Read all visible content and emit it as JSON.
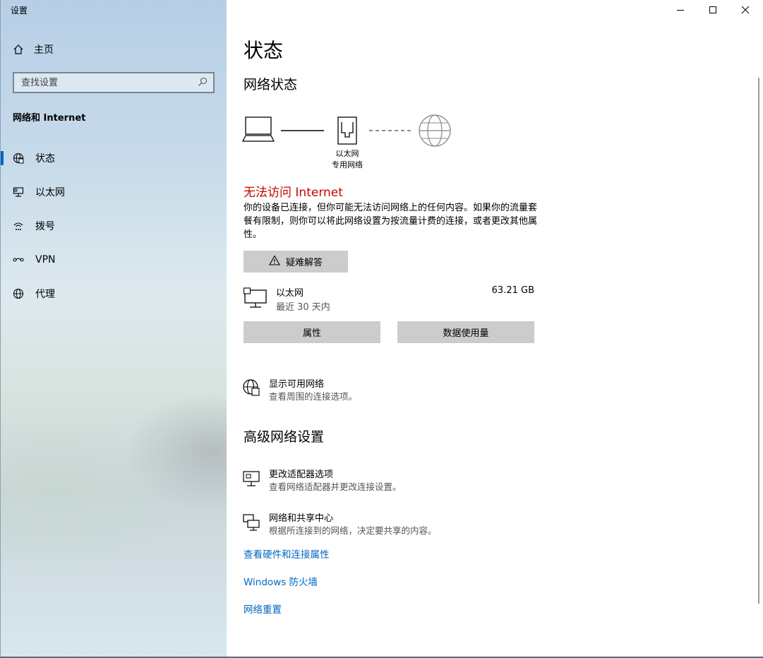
{
  "window": {
    "title": "设置"
  },
  "sidebar": {
    "home_label": "主页",
    "search_placeholder": "查找设置",
    "section_title": "网络和 Internet",
    "items": [
      {
        "label": "状态",
        "icon": "globe-status-icon",
        "active": true
      },
      {
        "label": "以太网",
        "icon": "ethernet-icon",
        "active": false
      },
      {
        "label": "拨号",
        "icon": "dialup-icon",
        "active": false
      },
      {
        "label": "VPN",
        "icon": "vpn-icon",
        "active": false
      },
      {
        "label": "代理",
        "icon": "globe-icon",
        "active": false
      }
    ]
  },
  "main": {
    "page_title": "状态",
    "network_status_heading": "网络状态",
    "diagram": {
      "label_line1": "以太网",
      "label_line2": "专用网络"
    },
    "warning_title": "无法访问 Internet",
    "warning_body": "你的设备已连接，但你可能无法访问网络上的任何内容。如果你的流量套餐有限制，则你可以将此网络设置为按流量计费的连接，或者更改其他属性。",
    "troubleshoot_label": "疑难解答",
    "connection": {
      "name": "以太网",
      "period": "最近 30 天内",
      "usage": "63.21 GB"
    },
    "properties_label": "属性",
    "data_usage_label": "数据使用量",
    "show_networks": {
      "title": "显示可用网络",
      "desc": "查看周围的连接选项。"
    },
    "advanced_heading": "高级网络设置",
    "adapter_options": {
      "title": "更改适配器选项",
      "desc": "查看网络适配器并更改连接设置。"
    },
    "sharing_center": {
      "title": "网络和共享中心",
      "desc": "根据所连接到的网络，决定要共享的内容。"
    },
    "links": [
      "查看硬件和连接属性",
      "Windows 防火墙",
      "网络重置"
    ]
  },
  "colors": {
    "accent": "#0067c0",
    "error": "#c50500",
    "button_bg": "#cccccc"
  }
}
